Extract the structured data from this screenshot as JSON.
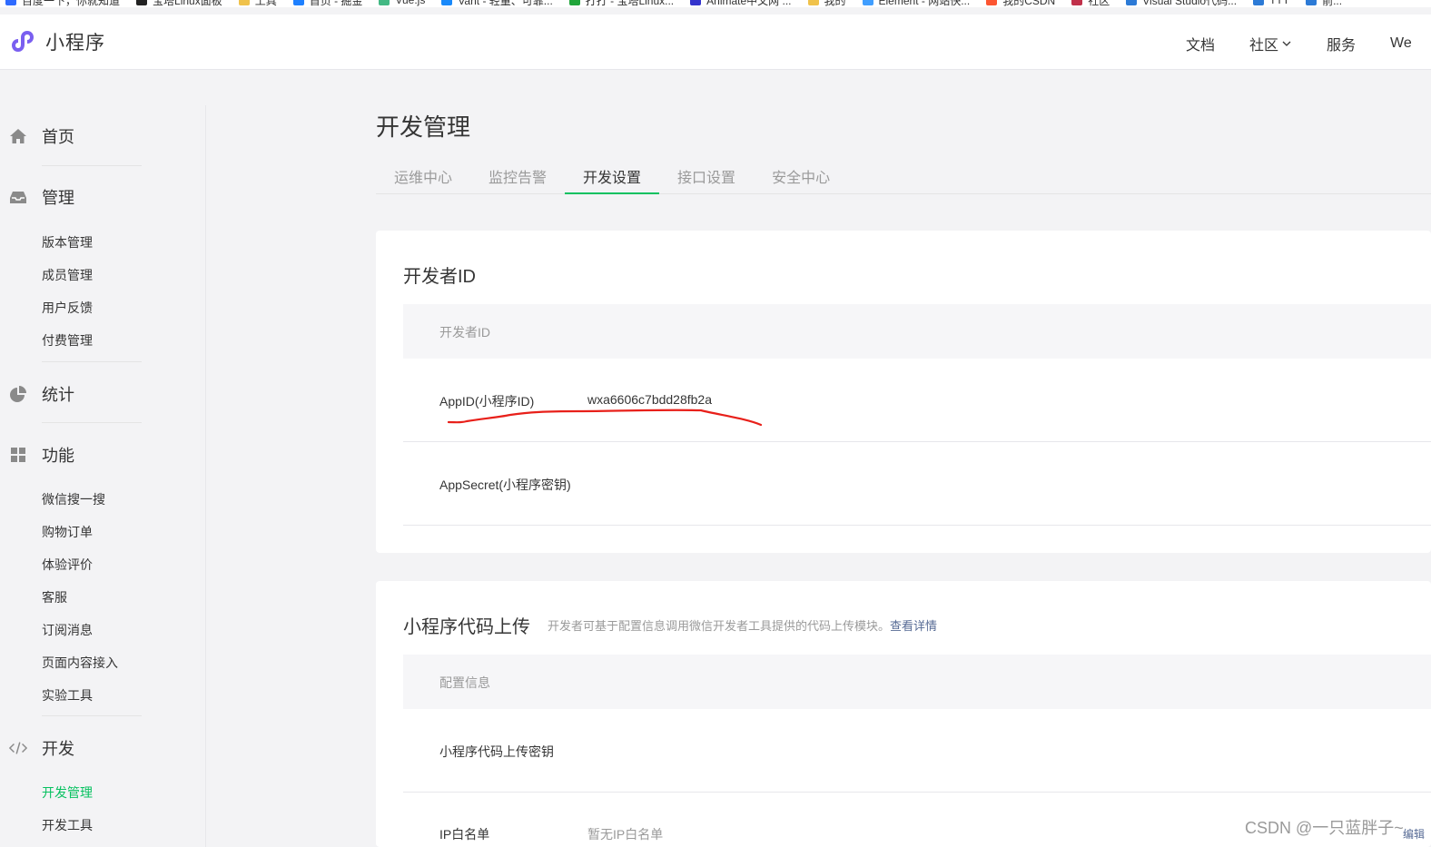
{
  "bookmarks": [
    {
      "label": "百度一下，你就知道",
      "color": "#2f6bff"
    },
    {
      "label": "宝塔Linux面板",
      "color": "#222222"
    },
    {
      "label": "工具",
      "color": "#f0c24b"
    },
    {
      "label": "首页 - 掘金",
      "color": "#1e80ff"
    },
    {
      "label": "Vue.js",
      "color": "#42b883"
    },
    {
      "label": "Vant - 轻量、可靠...",
      "color": "#1989fa"
    },
    {
      "label": "打打 - 宝塔Linux...",
      "color": "#20a53a"
    },
    {
      "label": "Animate中文网 ...",
      "color": "#3333cc"
    },
    {
      "label": "我的",
      "color": "#f0c24b"
    },
    {
      "label": "Element - 网站快...",
      "color": "#409eff"
    },
    {
      "label": "我的CSDN",
      "color": "#fc5531"
    },
    {
      "label": "社区",
      "color": "#c0304a"
    },
    {
      "label": "Visual Studio代码...",
      "color": "#2c7ad6"
    },
    {
      "label": "TTT",
      "color": "#2c7ad6"
    },
    {
      "label": "前...",
      "color": "#2c7ad6"
    }
  ],
  "header": {
    "logo_text": "小程序",
    "logo_color": "#7a5ff0",
    "nav": [
      "文档",
      "社区",
      "服务",
      "We"
    ]
  },
  "sidebar": {
    "groups": [
      {
        "label": "首页",
        "icon": "home-icon"
      },
      {
        "label": "管理",
        "icon": "inbox-icon",
        "items": [
          "版本管理",
          "成员管理",
          "用户反馈",
          "付费管理"
        ]
      },
      {
        "label": "统计",
        "icon": "pie-chart-icon"
      },
      {
        "label": "功能",
        "icon": "grid-icon",
        "items": [
          "微信搜一搜",
          "购物订单",
          "体验评价",
          "客服",
          "订阅消息",
          "页面内容接入",
          "实验工具"
        ]
      },
      {
        "label": "开发",
        "icon": "code-icon",
        "items": [
          "开发管理",
          "开发工具"
        ]
      }
    ],
    "active_item": "开发管理"
  },
  "main": {
    "title": "开发管理",
    "tabs": [
      "运维中心",
      "监控告警",
      "开发设置",
      "接口设置",
      "安全中心"
    ],
    "active_tab": "开发设置",
    "dev_id_card": {
      "title": "开发者ID",
      "header": "开发者ID",
      "rows": [
        {
          "label": "AppID(小程序ID)",
          "value": "wxa6606c7bdd28fb2a"
        },
        {
          "label": "AppSecret(小程序密钥)",
          "value": ""
        }
      ]
    },
    "upload_card": {
      "title": "小程序代码上传",
      "desc": "开发者可基于配置信息调用微信开发者工具提供的代码上传模块。",
      "desc_link": "查看详情",
      "header": "配置信息",
      "rows": [
        {
          "label": "小程序代码上传密钥",
          "value": ""
        },
        {
          "label": "IP白名单",
          "value": "暂无IP白名单"
        }
      ],
      "edit_label": "编辑"
    }
  },
  "colors": {
    "accent": "#07c160",
    "link": "#576b95",
    "annotation": "#e8201a"
  },
  "watermark": "CSDN @一只蓝胖子~"
}
